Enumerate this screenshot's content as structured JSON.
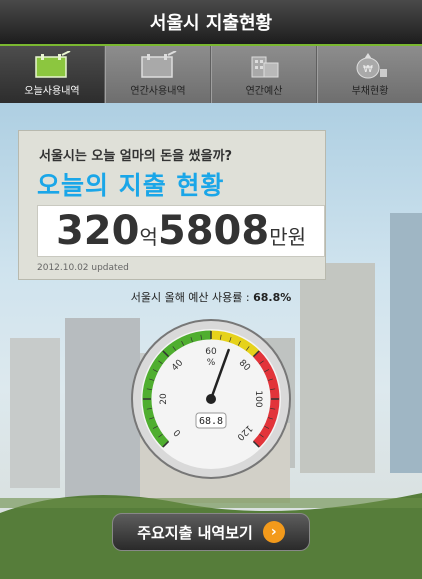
{
  "header": {
    "title": "서울시 지출현황"
  },
  "tabs": [
    {
      "label": "오늘사용내역",
      "icon": "today-calendar-icon",
      "active": true
    },
    {
      "label": "연간사용내역",
      "icon": "year-calendar-icon",
      "active": false
    },
    {
      "label": "연간예산",
      "icon": "budget-building-icon",
      "active": false
    },
    {
      "label": "부채현황",
      "icon": "money-bag-icon",
      "active": false
    }
  ],
  "today_card": {
    "question": "서울시는 오늘 얼마의 돈을 썼을까?",
    "headline": "오늘의 지출 현황",
    "amount_1": "320",
    "unit_1": "억",
    "amount_2": "5808",
    "unit_2": "만원",
    "updated": "2012.10.02 updated"
  },
  "budget_ratio": {
    "label": "서울시 올해 예산 사용률 : ",
    "value": "68.8%"
  },
  "gauge": {
    "value": 68.8,
    "display": "68.8",
    "unit_label": "%",
    "ticks": [
      "0",
      "20",
      "40",
      "60",
      "80",
      "100",
      "120"
    ],
    "colors": {
      "green": "#4fae2f",
      "yellow": "#e6d21a",
      "red": "#e2343a"
    }
  },
  "cta": {
    "label": "주요지출 내역보기",
    "icon": "arrow-right-icon"
  }
}
